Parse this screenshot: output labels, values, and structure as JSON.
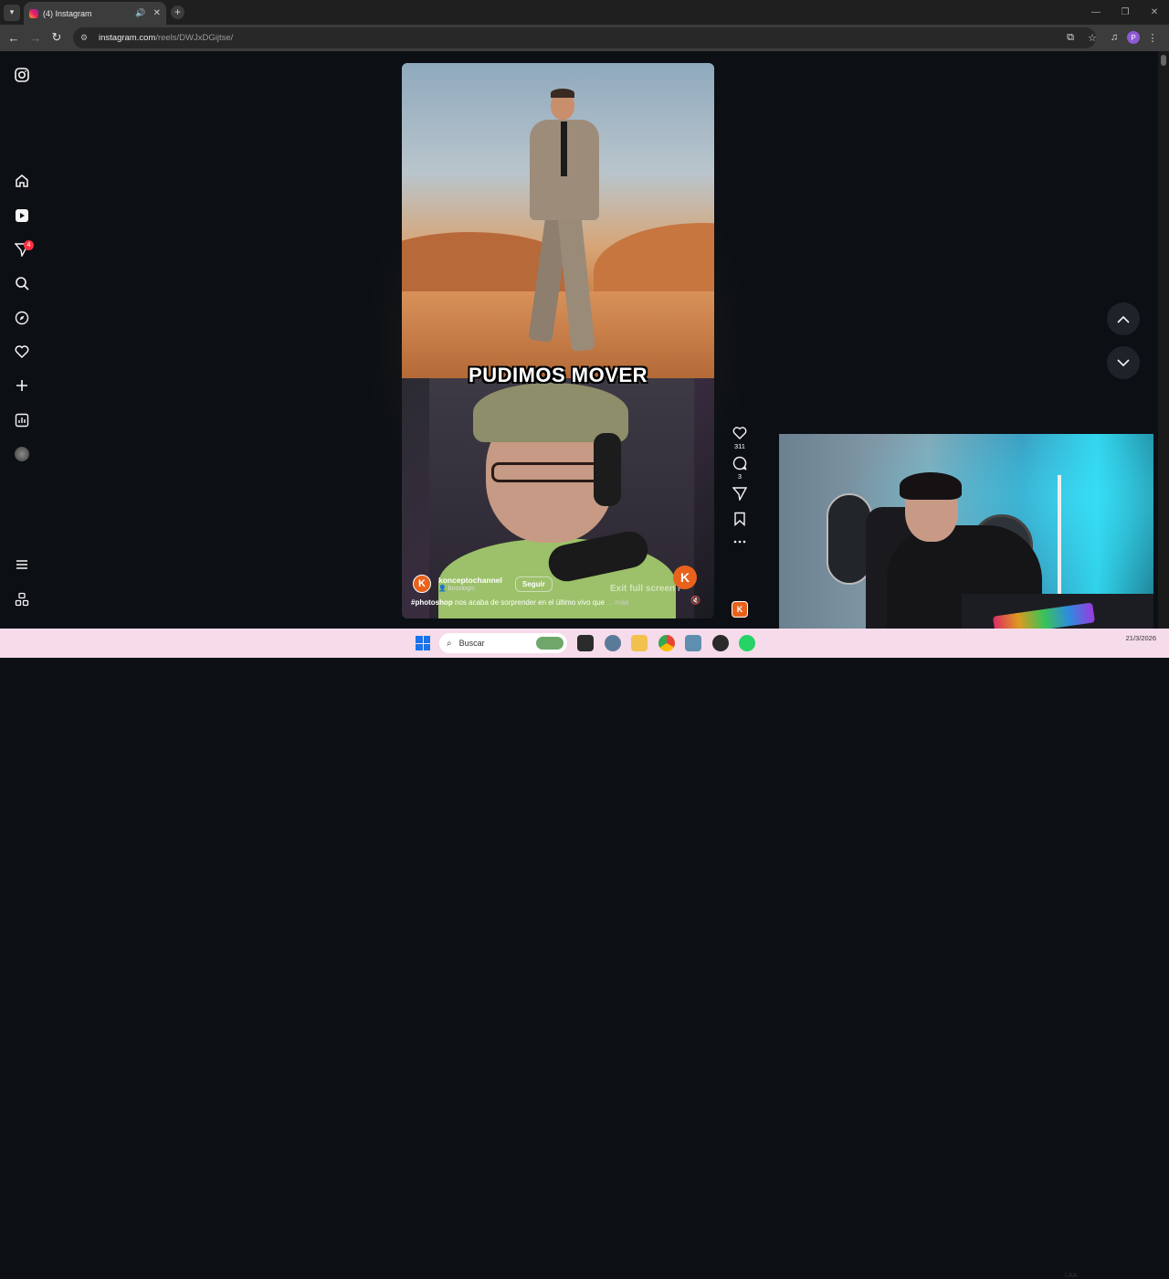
{
  "browser": {
    "tab_title": "(4) Instagram",
    "new_tab": "+",
    "url_host": "instagram.com",
    "url_path": "/reels/DWJxDGijtse/",
    "profile_initial": "P"
  },
  "sidebar": {
    "notification_count": "4"
  },
  "reel": {
    "overlay_caption": "PUDIMOS MOVER",
    "author": "konceptochannel",
    "collab": "bosslogic",
    "follow_label": "Seguir",
    "exit_fullscreen_hint": "Exit full screen",
    "exit_fullscreen_key": "F",
    "brand_mark": "K",
    "hashtag": "#photoshop",
    "description": " nos acaba de sorprender en el último vivo que",
    "more_label": " ... más",
    "likes": "311",
    "comments": "3"
  },
  "taskbar": {
    "search_placeholder": "Buscar",
    "lang": "LAA",
    "date": "21/3/2026"
  },
  "colors": {
    "ig_background": "#0c1014",
    "notification_badge": "#ff3040",
    "brand_orange": "#e8621c",
    "taskbar": "#f6dbea"
  }
}
